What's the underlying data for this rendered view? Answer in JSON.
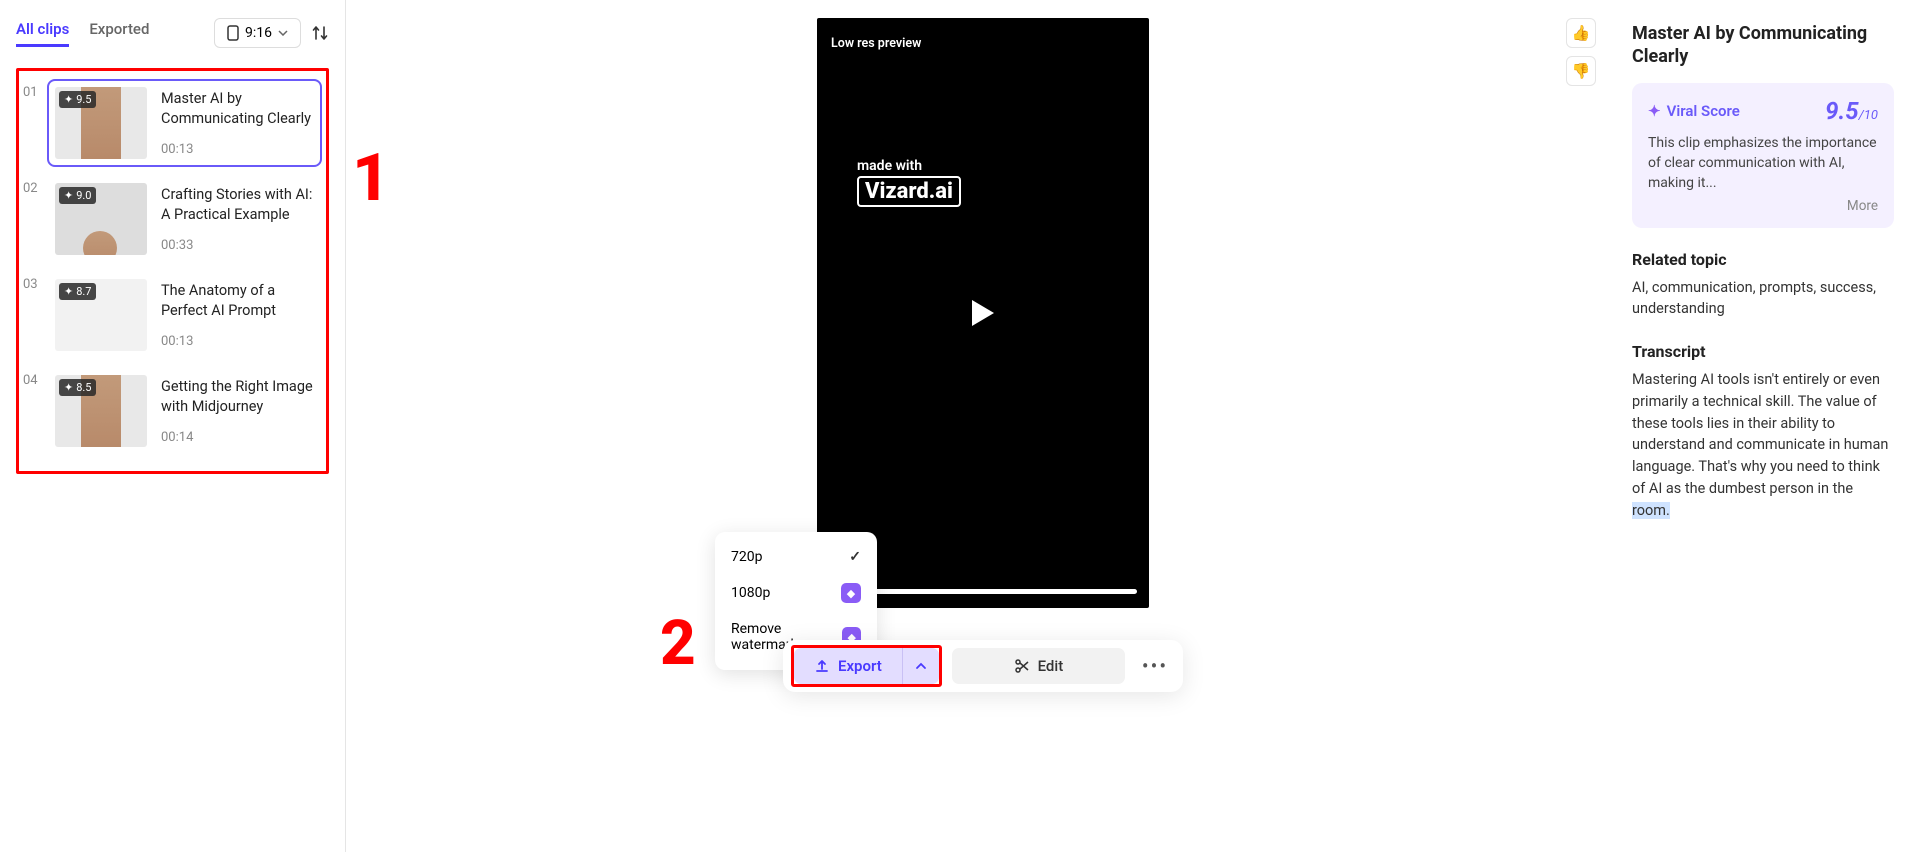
{
  "tabs": {
    "all": "All clips",
    "exported": "Exported"
  },
  "aspect": "9:16",
  "clips": [
    {
      "idx": "01",
      "score": "9.5",
      "title": "Master AI by Communicating Clearly",
      "dur": "00:13"
    },
    {
      "idx": "02",
      "score": "9.0",
      "title": "Crafting Stories with AI: A Practical Example",
      "dur": "00:33"
    },
    {
      "idx": "03",
      "score": "8.7",
      "title": "The Anatomy of a Perfect AI Prompt",
      "dur": "00:13"
    },
    {
      "idx": "04",
      "score": "8.5",
      "title": "Getting the Right Image with Midjourney",
      "dur": "00:14"
    }
  ],
  "annotations": {
    "one": "1",
    "two": "2"
  },
  "preview": {
    "low_res": "Low res preview",
    "made_with": "made with",
    "brand": "Vizard.ai"
  },
  "export_menu": {
    "r720": "720p",
    "r1080": "1080p",
    "remove_wm": "Remove watermark"
  },
  "actions": {
    "export": "Export",
    "edit": "Edit"
  },
  "right": {
    "title": "Master AI by Communicating Clearly",
    "viral_label": "Viral Score",
    "viral_score": "9.5",
    "viral_den": "/10",
    "viral_body": "This clip emphasizes the importance of clear communication with AI, making it...",
    "more": "More",
    "related_h": "Related topic",
    "related_txt": "AI, communication, prompts, success, understanding",
    "transcript_h": "Transcript",
    "transcript_txt": "Mastering AI tools isn't entirely or even primarily a technical skill. The value of these tools lies in their ability to understand and communicate in human language. That's why you need to think of AI as the dumbest person in the ",
    "transcript_hl": "room."
  }
}
